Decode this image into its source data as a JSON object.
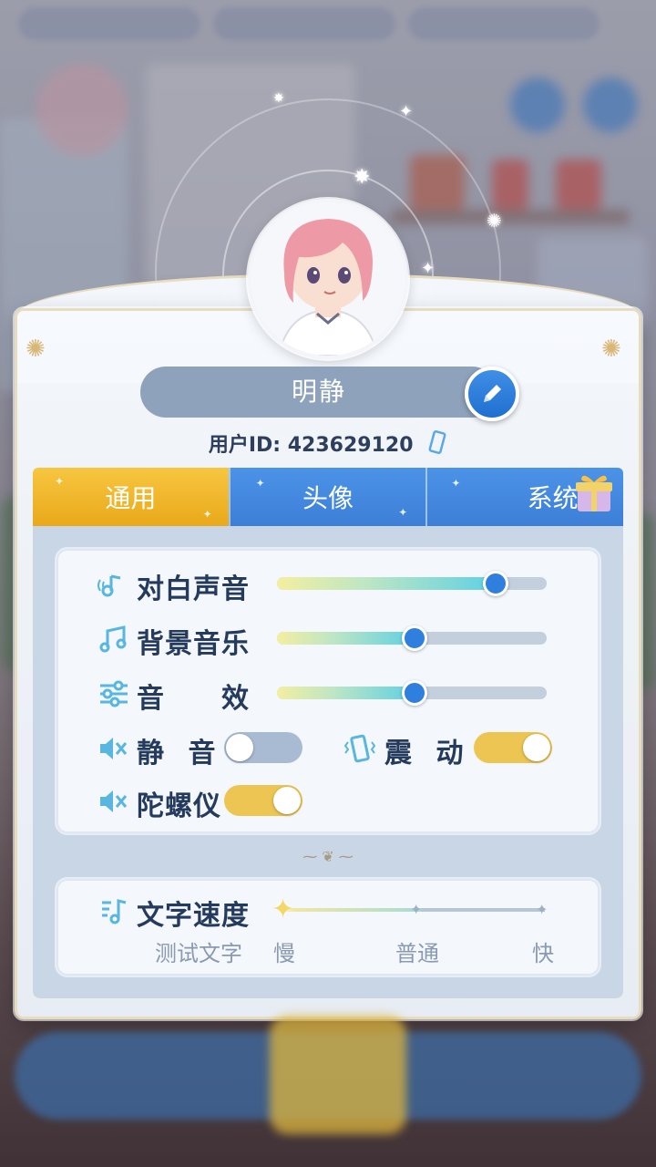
{
  "profile": {
    "name": "明静",
    "user_id_label": "用户ID:",
    "user_id": "423629120"
  },
  "tabs": [
    {
      "label": "通用",
      "active": true
    },
    {
      "label": "头像",
      "active": false
    },
    {
      "label": "系统",
      "active": false
    }
  ],
  "audio": {
    "dialogue": {
      "label": "对白声音",
      "level": 0.81
    },
    "bgm": {
      "label": "背景音乐",
      "level": 0.51
    },
    "sfx": {
      "label": "音　　效",
      "level": 0.51
    }
  },
  "toggles": {
    "mute": {
      "label": "静 音",
      "on": false
    },
    "vibration": {
      "label": "震 动",
      "on": true
    },
    "gyroscope": {
      "label": "陀螺仪",
      "on": true
    }
  },
  "text_speed": {
    "label": "文字速度",
    "test_label": "测试文字",
    "slow": "慢",
    "normal": "普通",
    "fast": "快",
    "value": "慢"
  },
  "colors": {
    "active_tab": "#f2bc34",
    "inactive_tab": "#4289e0",
    "slider_knob": "#2f7fde",
    "toggle_on": "#ecc552",
    "toggle_off": "#a9bbd3",
    "label_text": "#253b5e"
  }
}
